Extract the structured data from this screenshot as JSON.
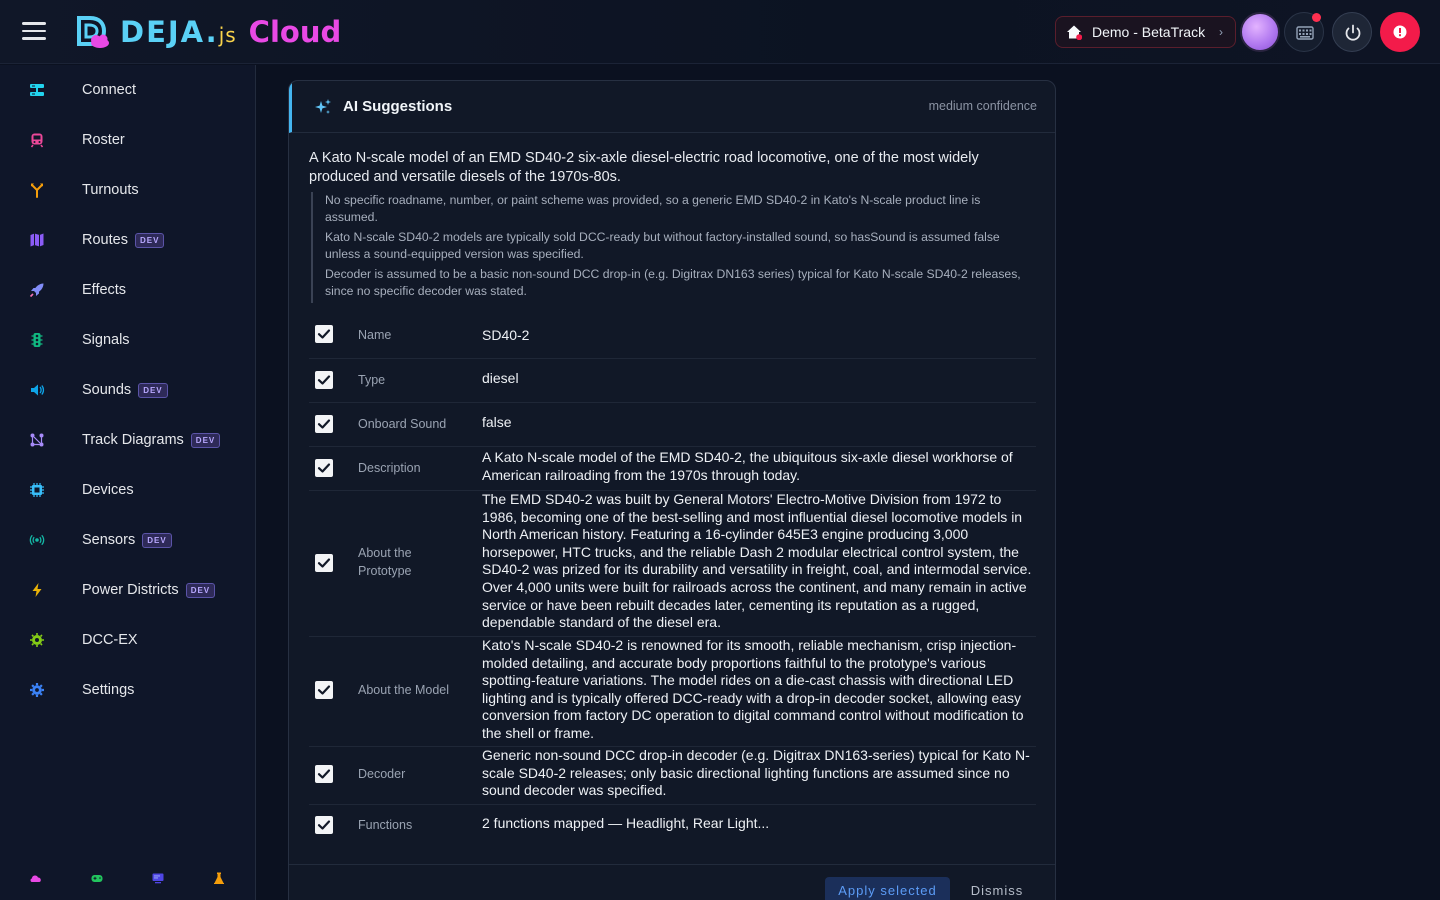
{
  "header": {
    "logo_deja": "DEJA",
    "logo_dot": ".",
    "logo_js": "js",
    "logo_cloud": "Cloud",
    "layout_selector": "Demo - BetaTrack"
  },
  "sidebar": {
    "items": [
      {
        "label": "Connect",
        "icon": "server-icon",
        "color": "#22d3ee",
        "dev": false
      },
      {
        "label": "Roster",
        "icon": "train-icon",
        "color": "#ec4899",
        "dev": false
      },
      {
        "label": "Turnouts",
        "icon": "fork-icon",
        "color": "#f59e0b",
        "dev": false
      },
      {
        "label": "Routes",
        "icon": "map-icon",
        "color": "#8b5cf6",
        "dev": true
      },
      {
        "label": "Effects",
        "icon": "rocket-icon",
        "color": "#818cf8",
        "dev": false
      },
      {
        "label": "Signals",
        "icon": "traffic-light-icon",
        "color": "#10b981",
        "dev": false
      },
      {
        "label": "Sounds",
        "icon": "speaker-icon",
        "color": "#0ea5e9",
        "dev": true
      },
      {
        "label": "Track Diagrams",
        "icon": "diagram-icon",
        "color": "#a78bfa",
        "dev": true
      },
      {
        "label": "Devices",
        "icon": "chip-icon",
        "color": "#38bdf8",
        "dev": false
      },
      {
        "label": "Sensors",
        "icon": "broadcast-icon",
        "color": "#14b8a6",
        "dev": true
      },
      {
        "label": "Power Districts",
        "icon": "lightning-icon",
        "color": "#eab308",
        "dev": true
      },
      {
        "label": "DCC-EX",
        "icon": "cog-chip-icon",
        "color": "#84cc16",
        "dev": false
      },
      {
        "label": "Settings",
        "icon": "gear-icon",
        "color": "#3b82f6",
        "dev": false
      }
    ],
    "dev_badge": "DEV",
    "footer_icons": [
      "cloud-icon",
      "gamepad-icon",
      "monitor-icon",
      "flask-icon"
    ]
  },
  "suggestions": {
    "title": "AI Suggestions",
    "confidence": "medium confidence",
    "summary": "A Kato N-scale model of an EMD SD40-2 six-axle diesel-electric road locomotive, one of the most widely produced and versatile diesels of the 1970s-80s.",
    "assumptions": [
      "No specific roadname, number, or paint scheme was provided, so a generic EMD SD40-2 in Kato's N-scale product line is assumed.",
      "Kato N-scale SD40-2 models are typically sold DCC-ready but without factory-installed sound, so hasSound is assumed false unless a sound-equipped version was specified.",
      "Decoder is assumed to be a basic non-sound DCC drop-in (e.g. Digitrax DN163 series) typical for Kato N-scale SD40-2 releases, since no specific decoder was stated."
    ],
    "fields": [
      {
        "label": "Name",
        "value": "SD40-2",
        "checked": true
      },
      {
        "label": "Type",
        "value": "diesel",
        "checked": true
      },
      {
        "label": "Onboard Sound",
        "value": "false",
        "checked": true
      },
      {
        "label": "Description",
        "value": "A Kato N-scale model of the EMD SD40-2, the ubiquitous six-axle diesel workhorse of American railroading from the 1970s through today.",
        "checked": true
      },
      {
        "label": "About the Prototype",
        "value": "The EMD SD40-2 was built by General Motors' Electro-Motive Division from 1972 to 1986, becoming one of the best-selling and most influential diesel locomotive models in North American history. Featuring a 16-cylinder 645E3 engine producing 3,000 horsepower, HTC trucks, and the reliable Dash 2 modular electrical control system, the SD40-2 was prized for its durability and versatility in freight, coal, and intermodal service. Over 4,000 units were built for railroads across the continent, and many remain in active service or have been rebuilt decades later, cementing its reputation as a rugged, dependable standard of the diesel era.",
        "checked": true
      },
      {
        "label": "About the Model",
        "value": "Kato's N-scale SD40-2 is renowned for its smooth, reliable mechanism, crisp injection-molded detailing, and accurate body proportions faithful to the prototype's various spotting-feature variations. The model rides on a die-cast chassis with directional LED lighting and is typically offered DCC-ready with a drop-in decoder socket, allowing easy conversion from factory DC operation to digital command control without modification to the shell or frame.",
        "checked": true
      },
      {
        "label": "Decoder",
        "value": "Generic non-sound DCC drop-in decoder (e.g. Digitrax DN163-series) typical for Kato N-scale SD40-2 releases; only basic directional lighting functions are assumed since no sound decoder was specified.",
        "checked": true
      },
      {
        "label": "Functions",
        "value": "2 functions mapped — Headlight, Rear Light...",
        "checked": true
      }
    ],
    "apply_label": "Apply selected",
    "dismiss_label": "Dismiss"
  },
  "colors": {
    "accent": "#45b5f0",
    "alert": "#f31b4a",
    "brand_cyan": "#5ad1f6",
    "brand_magenta": "#e949e5"
  }
}
